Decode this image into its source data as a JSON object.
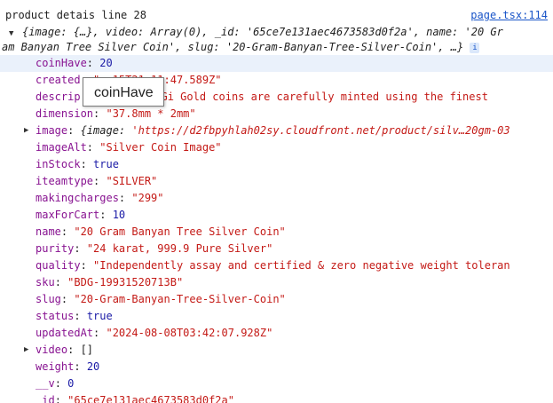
{
  "header": {
    "message": "product detais  line 28",
    "source_link": "page.tsx:114"
  },
  "summary": {
    "line1": "{image: {…}, video: Array(0), _id: '65ce7e131aec4673583d0f2a', name: '20 Gr",
    "line2": "am Banyan Tree Silver Coin', slug: '20-Gram-Banyan-Tree-Silver-Coin', …}",
    "info_badge": "i"
  },
  "tooltip": "coinHave",
  "props": {
    "coinHave": {
      "key": "coinHave",
      "value": "20"
    },
    "createdAt": {
      "key": "created",
      "value": "\"        -15T21:11:47.589Z\""
    },
    "description": {
      "key": "descrip",
      "value": "t DiGi Gold coins are carefully minted using the finest"
    },
    "dimension": {
      "key": "dimension",
      "value": "\"37.8mm * 2mm\""
    },
    "image": {
      "key": "image",
      "value_prefix": "{image: ",
      "value": "'https://d2fbpyhlah02sy.cloudfront.net/product/silv…20gm-03"
    },
    "imageAlt": {
      "key": "imageAlt",
      "value": "\"Silver Coin Image\""
    },
    "inStock": {
      "key": "inStock",
      "value": "true"
    },
    "iteamtype": {
      "key": "iteamtype",
      "value": "\"SILVER\""
    },
    "makingcharges": {
      "key": "makingcharges",
      "value": "\"299\""
    },
    "maxForCart": {
      "key": "maxForCart",
      "value": "10"
    },
    "name": {
      "key": "name",
      "value": "\"20 Gram Banyan Tree Silver Coin\""
    },
    "purity": {
      "key": "purity",
      "value": "\"24 karat, 999.9 Pure Silver\""
    },
    "quality": {
      "key": "quality",
      "value": "\"Independently assay and certified & zero negative weight toleran"
    },
    "sku": {
      "key": "sku",
      "value": "\"BDG-19931520713B\""
    },
    "slug": {
      "key": "slug",
      "value": "\"20-Gram-Banyan-Tree-Silver-Coin\""
    },
    "status": {
      "key": "status",
      "value": "true"
    },
    "updatedAt": {
      "key": "updatedAt",
      "value": "\"2024-08-08T03:42:07.928Z\""
    },
    "video": {
      "key": "video",
      "value": "[]"
    },
    "weight": {
      "key": "weight",
      "value": "20"
    },
    "__v": {
      "key": "__v",
      "value": "0"
    },
    "_id": {
      "key": "_id",
      "value": "\"65ce7e131aec4673583d0f2a\""
    }
  },
  "colors": {
    "key": "#881391",
    "string": "#c41a16",
    "number": "#1a1aa6",
    "link": "#1a55c8",
    "highlight": "#eaf1fb"
  },
  "icons": {
    "expand": "triangle-right-icon",
    "collapse": "triangle-down-icon",
    "info": "info-icon"
  }
}
